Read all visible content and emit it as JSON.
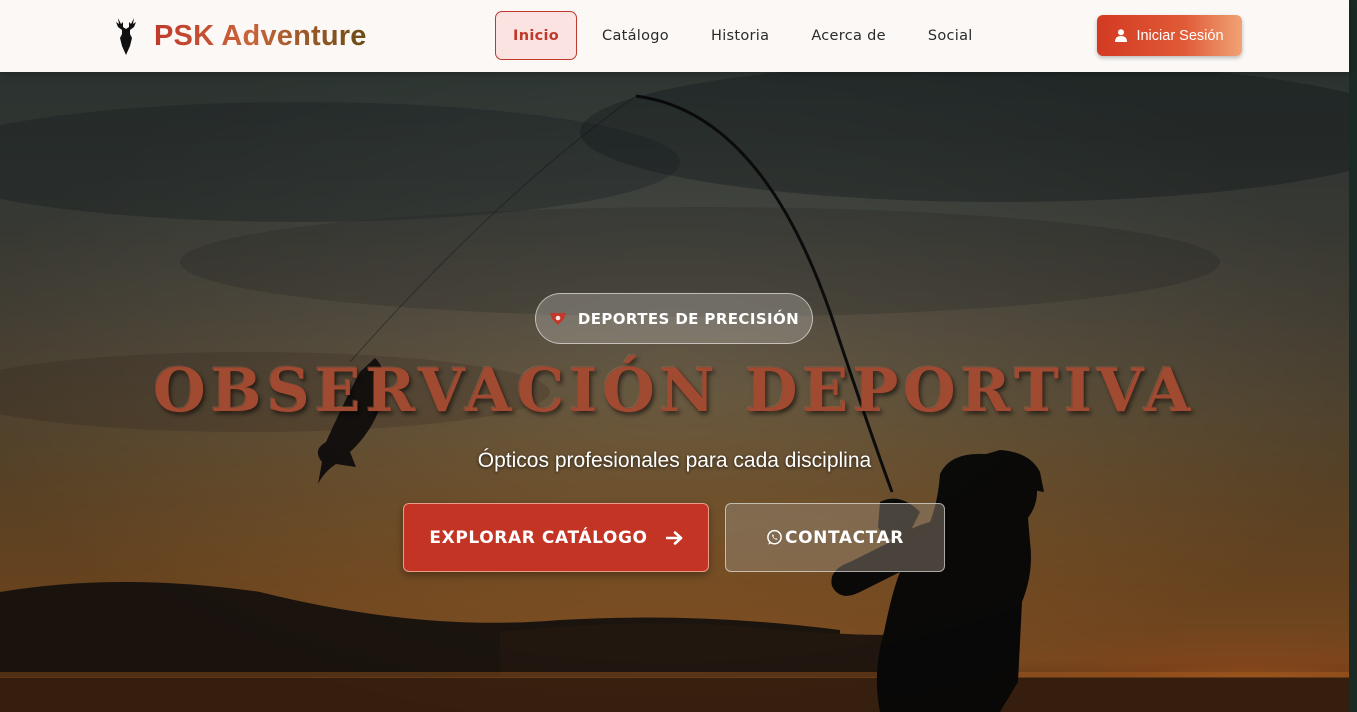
{
  "brand": {
    "name": "PSK Adventure",
    "logo_icon": "deer-head-icon"
  },
  "nav": {
    "items": [
      {
        "label": "Inicio",
        "active": true
      },
      {
        "label": "Catálogo",
        "active": false
      },
      {
        "label": "Historia",
        "active": false
      },
      {
        "label": "Acerca de",
        "active": false
      },
      {
        "label": "Social",
        "active": false
      }
    ],
    "login_label": "Iniciar Sesión",
    "login_icon": "user-icon"
  },
  "hero": {
    "badge_label": "DEPORTES DE PRECISIÓN",
    "badge_icon": "bullseye-icon",
    "title": "OBSERVACIÓN DEPORTIVA",
    "subtitle": "Ópticos profesionales para cada disciplina",
    "primary_cta": "EXPLORAR CATÁLOGO",
    "primary_cta_icon": "arrow-right-icon",
    "secondary_cta": "CONTACTAR",
    "secondary_cta_icon": "whatsapp-icon",
    "background": "fisherman-sunset-photo"
  },
  "colors": {
    "accent": "#c0392b",
    "active_nav_bg": "#fbe3e1",
    "nav_bg": "#fbf8f6",
    "login_gradient_end": "#f0a376"
  }
}
